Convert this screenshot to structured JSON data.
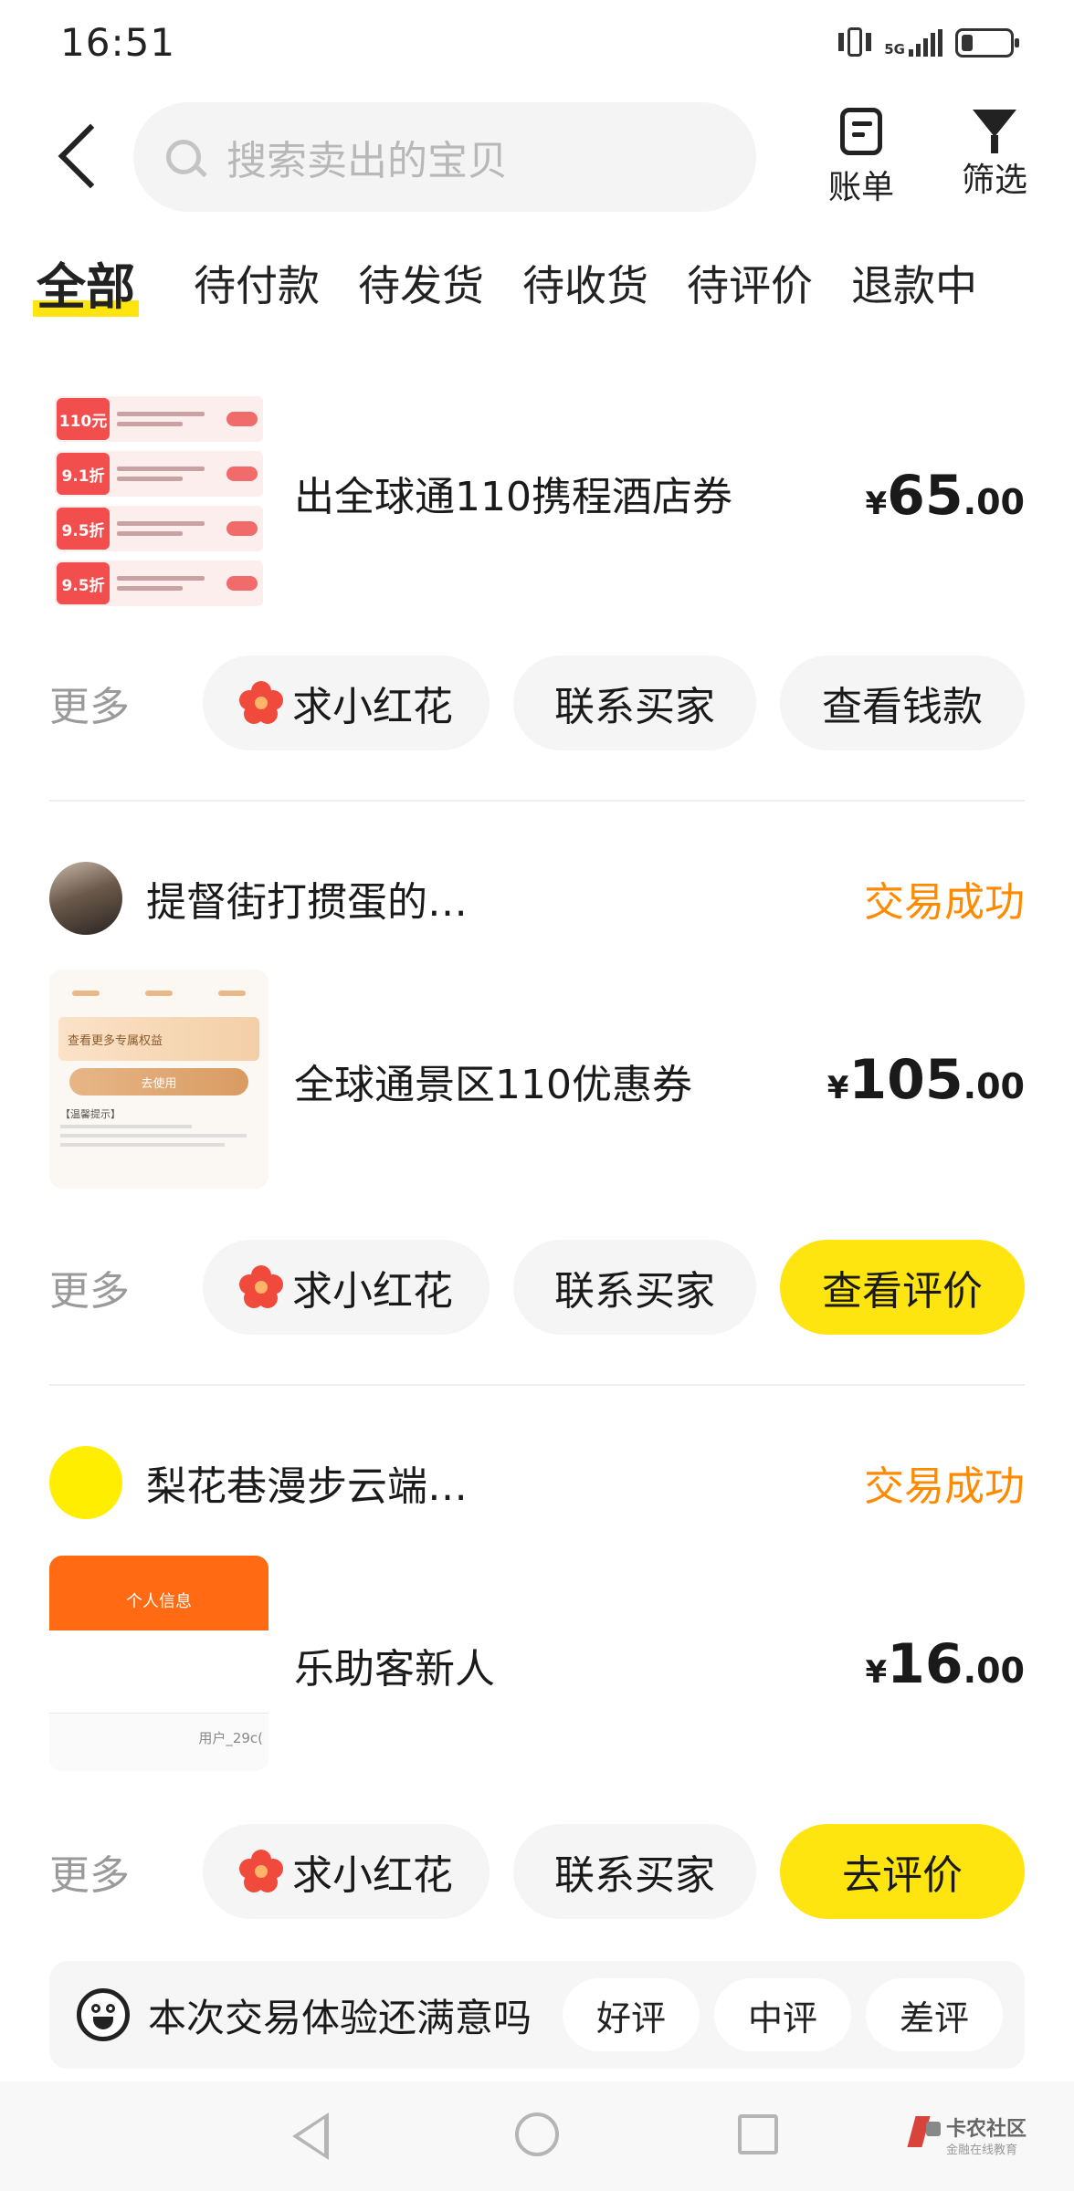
{
  "status_bar": {
    "time": "16:51",
    "network": "5G",
    "battery_level": 0.25
  },
  "header": {
    "search_placeholder": "搜索卖出的宝贝",
    "bill_label": "账单",
    "filter_label": "筛选"
  },
  "tabs": [
    {
      "label": "全部",
      "active": true
    },
    {
      "label": "待付款"
    },
    {
      "label": "待发货"
    },
    {
      "label": "待收货"
    },
    {
      "label": "待评价"
    },
    {
      "label": "退款中"
    }
  ],
  "orders": [
    {
      "title": "出全球通110携程酒店券",
      "price_currency": "¥",
      "price_int": "65",
      "price_dec": ".00",
      "more_label": "更多",
      "actions": [
        "求小红花",
        "联系买家",
        "查看钱款"
      ],
      "thumb_tags": [
        "110元",
        "9.1折",
        "9.5折",
        "9.5折"
      ]
    },
    {
      "seller": "提督街打掼蛋的…",
      "status": "交易成功",
      "title": "全球通景区110优惠券",
      "price_currency": "¥",
      "price_int": "105",
      "price_dec": ".00",
      "more_label": "更多",
      "actions": [
        "求小红花",
        "联系买家",
        "查看评价"
      ],
      "thumb_texts": [
        "查看更多专属权益",
        "去使用",
        "【温馨提示】"
      ]
    },
    {
      "seller": "梨花巷漫步云端…",
      "status": "交易成功",
      "title": "乐助客新人",
      "price_currency": "¥",
      "price_int": "16",
      "price_dec": ".00",
      "more_label": "更多",
      "actions": [
        "求小红花",
        "联系买家",
        "去评价"
      ],
      "thumb_texts": [
        "个人信息",
        "用户_29c("
      ]
    }
  ],
  "survey": {
    "question": "本次交易体验还满意吗",
    "options": [
      "好评",
      "中评",
      "差评"
    ]
  },
  "watermark": {
    "title": "卡农社区",
    "subtitle": "金融在线教育"
  },
  "colors": {
    "accent_yellow": "#ffe50f",
    "status_orange": "#ff8a00",
    "flower_red": "#ef4a3b"
  }
}
